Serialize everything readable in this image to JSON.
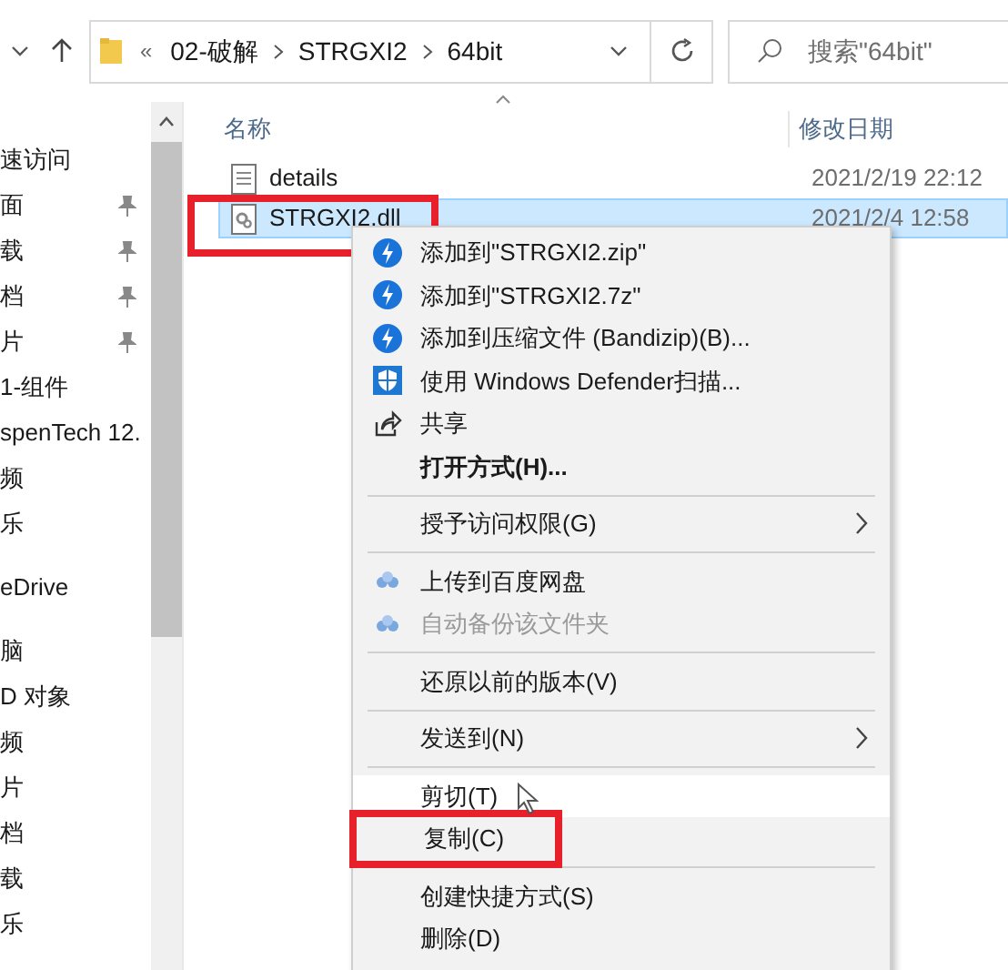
{
  "nav": {
    "breadcrumb": [
      "«",
      "02-破解",
      "STRGXI2",
      "64bit"
    ],
    "search": {
      "placeholder": "搜索\"64bit\""
    }
  },
  "sidebar": {
    "items": [
      {
        "label": "速访问",
        "pinned": false
      },
      {
        "label": "面",
        "pinned": true
      },
      {
        "label": "载",
        "pinned": true
      },
      {
        "label": "档",
        "pinned": true
      },
      {
        "label": "片",
        "pinned": true
      },
      {
        "label": "1-组件",
        "pinned": false
      },
      {
        "label": "spenTech 12.",
        "pinned": false
      },
      {
        "label": "频",
        "pinned": false
      },
      {
        "label": "乐",
        "pinned": false
      },
      {
        "label": "eDrive",
        "pinned": false
      },
      {
        "label": "脑",
        "pinned": false
      },
      {
        "label": "D 对象",
        "pinned": false
      },
      {
        "label": "频",
        "pinned": false
      },
      {
        "label": "片",
        "pinned": false
      },
      {
        "label": "档",
        "pinned": false
      },
      {
        "label": "载",
        "pinned": false
      },
      {
        "label": "乐",
        "pinned": false
      }
    ]
  },
  "table": {
    "columns": [
      "名称",
      "修改日期"
    ],
    "rows": [
      {
        "name": "details",
        "date": "2021/2/19 22:12",
        "kind": "text",
        "selected": false,
        "annotated": false
      },
      {
        "name": "STRGXI2.dll",
        "date": "2021/2/4 12:58",
        "kind": "dll",
        "selected": true,
        "annotated": true
      }
    ]
  },
  "context_menu": {
    "items": [
      {
        "kind": "bandizip",
        "label": "添加到\"STRGXI2.zip\"",
        "bold": false,
        "disabled": false,
        "submenu": false,
        "selected": false,
        "annotated": false
      },
      {
        "kind": "bandizip",
        "label": "添加到\"STRGXI2.7z\"",
        "bold": false,
        "disabled": false,
        "submenu": false,
        "selected": false,
        "annotated": false
      },
      {
        "kind": "bandizip",
        "label": "添加到压缩文件 (Bandizip)(B)...",
        "bold": false,
        "disabled": false,
        "submenu": false,
        "selected": false,
        "annotated": false
      },
      {
        "kind": "shield",
        "label": "使用 Windows Defender扫描...",
        "bold": false,
        "disabled": false,
        "submenu": false,
        "selected": false,
        "annotated": false
      },
      {
        "kind": "share",
        "label": "共享",
        "bold": false,
        "disabled": false,
        "submenu": false,
        "selected": false,
        "annotated": false
      },
      {
        "kind": "plain",
        "label": "打开方式(H)...",
        "bold": true,
        "disabled": false,
        "submenu": false,
        "selected": false,
        "annotated": false
      },
      {
        "kind": "separator"
      },
      {
        "kind": "plain",
        "label": "授予访问权限(G)",
        "bold": false,
        "disabled": false,
        "submenu": true,
        "selected": false,
        "annotated": false
      },
      {
        "kind": "separator"
      },
      {
        "kind": "cloud",
        "label": "上传到百度网盘",
        "bold": false,
        "disabled": false,
        "submenu": false,
        "selected": false,
        "annotated": false
      },
      {
        "kind": "cloud",
        "label": "自动备份该文件夹",
        "bold": false,
        "disabled": true,
        "submenu": false,
        "selected": false,
        "annotated": false
      },
      {
        "kind": "separator"
      },
      {
        "kind": "plain",
        "label": "还原以前的版本(V)",
        "bold": false,
        "disabled": false,
        "submenu": false,
        "selected": false,
        "annotated": false
      },
      {
        "kind": "separator"
      },
      {
        "kind": "plain",
        "label": "发送到(N)",
        "bold": false,
        "disabled": false,
        "submenu": true,
        "selected": false,
        "annotated": false
      },
      {
        "kind": "separator"
      },
      {
        "kind": "plain",
        "label": "剪切(T)",
        "bold": false,
        "disabled": false,
        "submenu": false,
        "selected": true,
        "annotated": false
      },
      {
        "kind": "plain",
        "label": "复制(C)",
        "bold": false,
        "disabled": false,
        "submenu": false,
        "selected": false,
        "annotated": true
      },
      {
        "kind": "separator"
      },
      {
        "kind": "plain",
        "label": "创建快捷方式(S)",
        "bold": false,
        "disabled": false,
        "submenu": false,
        "selected": false,
        "annotated": false
      },
      {
        "kind": "plain",
        "label": "删除(D)",
        "bold": false,
        "disabled": false,
        "submenu": false,
        "selected": false,
        "annotated": false
      }
    ]
  }
}
